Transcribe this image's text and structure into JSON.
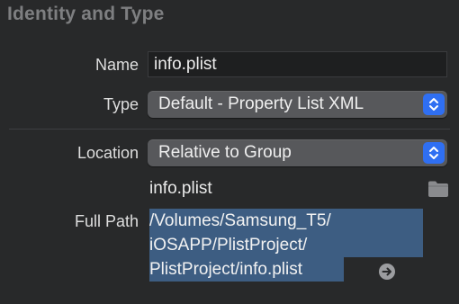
{
  "section": {
    "title": "Identity and Type"
  },
  "name": {
    "label": "Name",
    "value": "info.plist"
  },
  "type": {
    "label": "Type",
    "selected": "Default - Property List XML"
  },
  "location": {
    "label": "Location",
    "selected": "Relative to Group",
    "filename": "info.plist"
  },
  "full_path": {
    "label": "Full Path",
    "lines": [
      "/Volumes/Samsung_T5/",
      "iOSAPP/PlistProject/",
      "PlistProject/info.plist"
    ]
  },
  "icons": {
    "popup_stepper": "chevron-up-down-icon",
    "folder": "folder-icon",
    "reveal": "arrow-circle-right-icon"
  },
  "colors": {
    "accent": "#2f6ff2",
    "selection": "#3d5d82",
    "background": "#28292a"
  }
}
